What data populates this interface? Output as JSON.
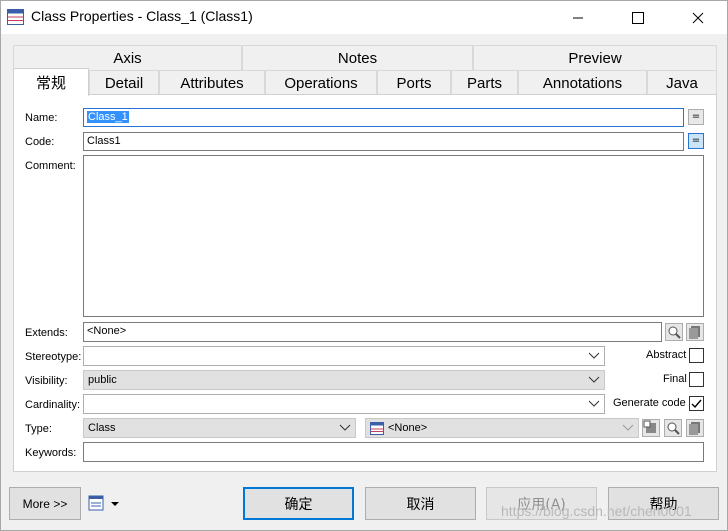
{
  "window": {
    "title": "Class Properties - Class_1 (Class1)",
    "icon": "class-table-icon"
  },
  "tabs_row1": [
    "Axis",
    "Notes",
    "Preview"
  ],
  "tabs_row2": [
    "常规",
    "Detail",
    "Attributes",
    "Operations",
    "Ports",
    "Parts",
    "Annotations",
    "Java"
  ],
  "active_tab": "常规",
  "form": {
    "name_label": "Name:",
    "name_value": "Class_1",
    "code_label": "Code:",
    "code_value": "Class1",
    "comment_label": "Comment:",
    "comment_value": "",
    "extends_label": "Extends:",
    "extends_value": "<None>",
    "stereotype_label": "Stereotype:",
    "stereotype_value": "",
    "visibility_label": "Visibility:",
    "visibility_value": "public",
    "cardinality_label": "Cardinality:",
    "cardinality_value": "",
    "type_label": "Type:",
    "type_value": "Class",
    "type_ref_value": "<None>",
    "keywords_label": "Keywords:",
    "keywords_value": "",
    "abstract_label": "Abstract",
    "abstract_checked": false,
    "final_label": "Final",
    "final_checked": false,
    "generate_label": "Generate code",
    "generate_checked": true,
    "eq_symbol": "="
  },
  "footer": {
    "more_label": "More >>",
    "ok_label": "确定",
    "cancel_label": "取消",
    "apply_label": "应用(A)",
    "help_label": "帮助"
  },
  "watermark": "https://blog.csdn.net/chen0001"
}
